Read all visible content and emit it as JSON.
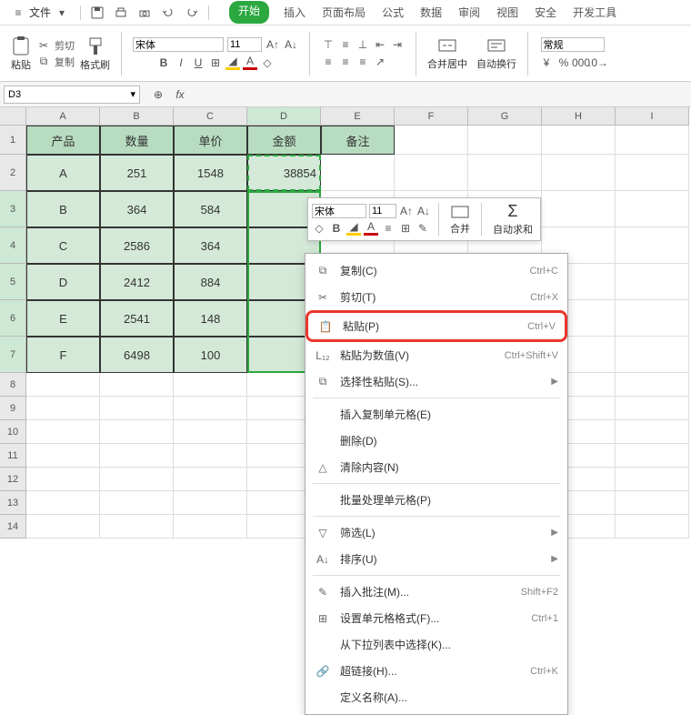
{
  "menu": {
    "file": "文件",
    "tabs": [
      "开始",
      "插入",
      "页面布局",
      "公式",
      "数据",
      "审阅",
      "视图",
      "安全",
      "开发工具"
    ]
  },
  "ribbon": {
    "paste": "粘贴",
    "cut": "剪切",
    "copy": "复制",
    "format_painter": "格式刷",
    "font_name": "宋体",
    "font_size": "11",
    "merge": "合并居中",
    "wrap": "自动换行",
    "number_format": "常规"
  },
  "formula_bar": {
    "name_box": "D3"
  },
  "columns": [
    "A",
    "B",
    "C",
    "D",
    "E",
    "F",
    "G",
    "H",
    "I"
  ],
  "row_numbers": [
    "1",
    "2",
    "3",
    "4",
    "5",
    "6",
    "7",
    "8",
    "9",
    "10",
    "11",
    "12",
    "13",
    "14"
  ],
  "table": {
    "headers": [
      "产品",
      "数量",
      "单价",
      "金额",
      "备注"
    ],
    "rows": [
      {
        "p": "A",
        "q": "251",
        "u": "1548",
        "a": "38854"
      },
      {
        "p": "B",
        "q": "364",
        "u": "584",
        "a": ""
      },
      {
        "p": "C",
        "q": "2586",
        "u": "364",
        "a": ""
      },
      {
        "p": "D",
        "q": "2412",
        "u": "884",
        "a": ""
      },
      {
        "p": "E",
        "q": "2541",
        "u": "148",
        "a": ""
      },
      {
        "p": "F",
        "q": "6498",
        "u": "100",
        "a": ""
      }
    ]
  },
  "mini": {
    "font_name": "宋体",
    "font_size": "11",
    "merge": "合并",
    "autosum": "自动求和"
  },
  "context": {
    "items": [
      {
        "icon": "copy",
        "label": "复制(C)",
        "shortcut": "Ctrl+C",
        "arrow": false
      },
      {
        "icon": "cut",
        "label": "剪切(T)",
        "shortcut": "Ctrl+X",
        "arrow": false
      },
      {
        "icon": "paste",
        "label": "粘贴(P)",
        "shortcut": "Ctrl+V",
        "arrow": false,
        "highlight": true
      },
      {
        "icon": "paste12",
        "label": "粘贴为数值(V)",
        "shortcut": "Ctrl+Shift+V",
        "arrow": false
      },
      {
        "icon": "paste-special",
        "label": "选择性粘贴(S)...",
        "shortcut": "",
        "arrow": true
      },
      {
        "sep": true
      },
      {
        "icon": "",
        "label": "插入复制单元格(E)",
        "shortcut": "",
        "arrow": false
      },
      {
        "icon": "",
        "label": "删除(D)",
        "shortcut": "",
        "arrow": false
      },
      {
        "icon": "clear",
        "label": "清除内容(N)",
        "shortcut": "",
        "arrow": false
      },
      {
        "sep": true
      },
      {
        "icon": "",
        "label": "批量处理单元格(P)",
        "shortcut": "",
        "arrow": false
      },
      {
        "sep": true
      },
      {
        "icon": "filter",
        "label": "筛选(L)",
        "shortcut": "",
        "arrow": true
      },
      {
        "icon": "sort",
        "label": "排序(U)",
        "shortcut": "",
        "arrow": true
      },
      {
        "sep": true
      },
      {
        "icon": "comment",
        "label": "插入批注(M)...",
        "shortcut": "Shift+F2",
        "arrow": false
      },
      {
        "icon": "format",
        "label": "设置单元格格式(F)...",
        "shortcut": "Ctrl+1",
        "arrow": false
      },
      {
        "icon": "",
        "label": "从下拉列表中选择(K)...",
        "shortcut": "",
        "arrow": false
      },
      {
        "icon": "link",
        "label": "超链接(H)...",
        "shortcut": "Ctrl+K",
        "arrow": false
      },
      {
        "icon": "",
        "label": "定义名称(A)...",
        "shortcut": "",
        "arrow": false
      }
    ]
  }
}
